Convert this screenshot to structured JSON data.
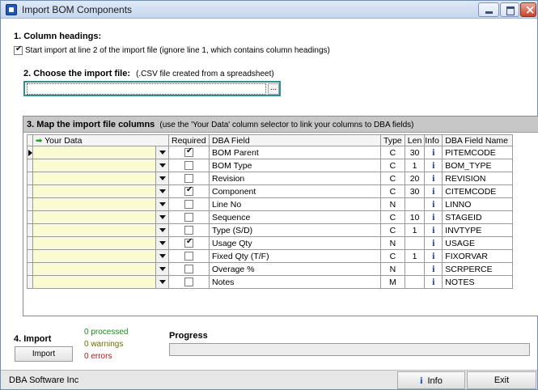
{
  "window": {
    "title": "Import BOM Components"
  },
  "section1": {
    "heading": "1. Column headings:",
    "checkbox_label": "Start import at line 2 of the import file (ignore line 1, which contains column headings)",
    "checked": true
  },
  "section2": {
    "heading": "2. Choose the import file:",
    "note": "(.CSV file created from a spreadsheet)",
    "file_value": "",
    "browse_label": "..."
  },
  "section3": {
    "heading": "3. Map the import file columns",
    "note": "(use the 'Your Data' column selector to link your columns to DBA fields)",
    "columns": {
      "your_data": "Your Data",
      "required": "Required",
      "dba_field": "DBA Field",
      "type": "Type",
      "len": "Len",
      "info": "Info",
      "dba_field_name": "DBA Field Name"
    },
    "rows": [
      {
        "your_data": "",
        "required": true,
        "field": "BOM Parent",
        "type": "C",
        "len": "30",
        "info": "i",
        "name": "PITEMCODE"
      },
      {
        "your_data": "",
        "required": false,
        "field": "BOM Type",
        "type": "C",
        "len": "1",
        "info": "i",
        "name": "BOM_TYPE"
      },
      {
        "your_data": "",
        "required": false,
        "field": "Revision",
        "type": "C",
        "len": "20",
        "info": "i",
        "name": "REVISION"
      },
      {
        "your_data": "",
        "required": true,
        "field": "Component",
        "type": "C",
        "len": "30",
        "info": "i",
        "name": "CITEMCODE"
      },
      {
        "your_data": "",
        "required": false,
        "field": "Line No",
        "type": "N",
        "len": "",
        "info": "i",
        "name": "LINNO"
      },
      {
        "your_data": "",
        "required": false,
        "field": "Sequence",
        "type": "C",
        "len": "10",
        "info": "i",
        "name": "STAGEID"
      },
      {
        "your_data": "",
        "required": false,
        "field": "Type (S/D)",
        "type": "C",
        "len": "1",
        "info": "i",
        "name": "INVTYPE"
      },
      {
        "your_data": "",
        "required": true,
        "field": "Usage Qty",
        "type": "N",
        "len": "",
        "info": "i",
        "name": "USAGE"
      },
      {
        "your_data": "",
        "required": false,
        "field": "Fixed Qty (T/F)",
        "type": "C",
        "len": "1",
        "info": "i",
        "name": "FIXORVAR"
      },
      {
        "your_data": "",
        "required": false,
        "field": "Overage %",
        "type": "N",
        "len": "",
        "info": "i",
        "name": "SCRPERCE"
      },
      {
        "your_data": "",
        "required": false,
        "field": "Notes",
        "type": "M",
        "len": "",
        "info": "i",
        "name": "NOTES"
      }
    ]
  },
  "section4": {
    "heading": "4. Import",
    "import_button": "Import",
    "processed": "0 processed",
    "warnings": "0 warnings",
    "errors": "0 errors",
    "progress_label": "Progress",
    "progress_value": 0
  },
  "statusbar": {
    "company": "DBA Software Inc",
    "info_icon": "i",
    "info_button": "Info",
    "exit_button": "Exit"
  },
  "colors": {
    "your_data_bg": "#fbfbd2",
    "section3_header_bg": "#c7c7c7",
    "processed": "#1f8a1f",
    "warnings": "#6e6e00",
    "errors": "#b01717",
    "info_icon": "#1b3fb5"
  }
}
